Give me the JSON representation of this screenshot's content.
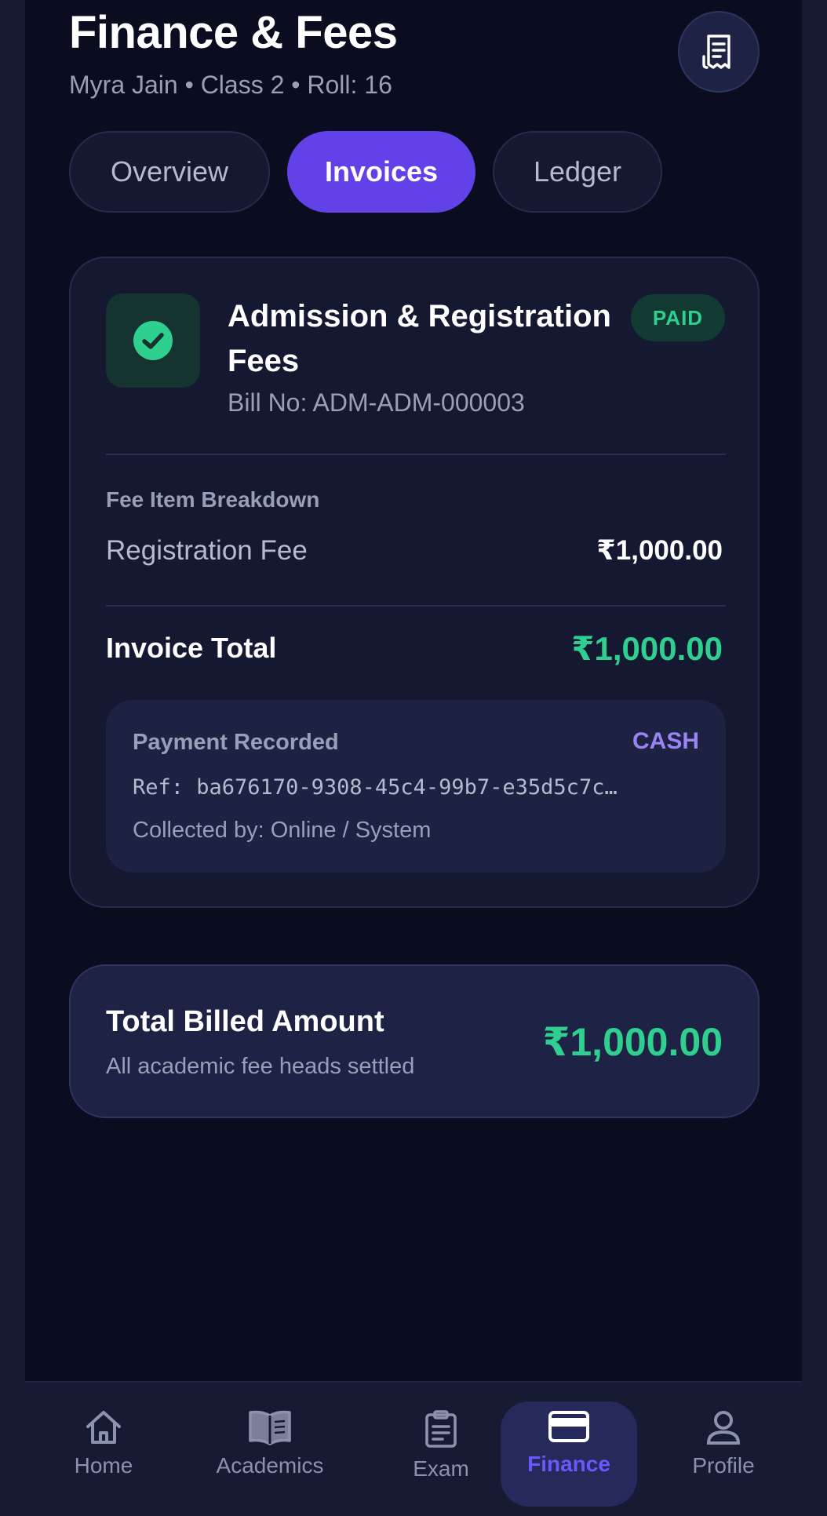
{
  "header": {
    "title": "Finance & Fees",
    "subtitle": "Myra Jain • Class 2 • Roll: 16"
  },
  "tabs": [
    {
      "label": "Overview",
      "active": false
    },
    {
      "label": "Invoices",
      "active": true
    },
    {
      "label": "Ledger",
      "active": false
    }
  ],
  "invoice": {
    "title": "Admission & Registration Fees",
    "status": "PAID",
    "bill_no": "Bill No: ADM-ADM-000003",
    "breakdown_label": "Fee Item Breakdown",
    "items": [
      {
        "name": "Registration Fee",
        "amount": "₹1,000.00"
      }
    ],
    "total_label": "Invoice Total",
    "total_amount": "₹1,000.00",
    "payment": {
      "label": "Payment Recorded",
      "mode": "CASH",
      "ref": "Ref: ba676170-9308-45c4-99b7-e35d5c7c…",
      "collector": "Collected by: Online / System"
    }
  },
  "summary": {
    "title": "Total Billed Amount",
    "subtitle": "All academic fee heads settled",
    "amount": "₹1,000.00"
  },
  "nav": [
    {
      "label": "Home",
      "icon": "home-icon",
      "active": false
    },
    {
      "label": "Academics",
      "icon": "book-icon",
      "active": false
    },
    {
      "label": "Exam",
      "icon": "clipboard-icon",
      "active": false
    },
    {
      "label": "Finance",
      "icon": "card-icon",
      "active": true
    },
    {
      "label": "Profile",
      "icon": "user-icon",
      "active": false
    }
  ],
  "colors": {
    "accent": "#6241e8",
    "success": "#2fcf8f",
    "background": "#090d1f",
    "card": "#141831"
  }
}
